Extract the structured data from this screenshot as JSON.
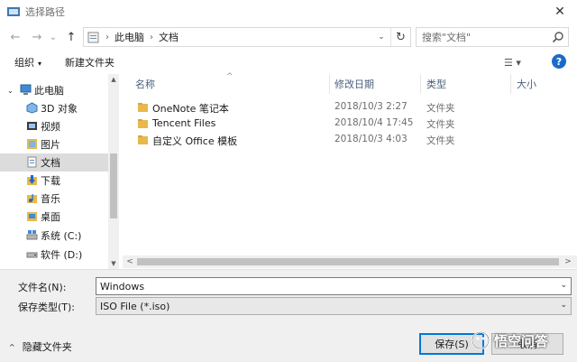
{
  "window": {
    "title": "选择路径",
    "close_glyph": "✕"
  },
  "nav": {
    "back_glyph": "←",
    "forward_glyph": "→",
    "recent_glyph": "⌄",
    "up_glyph": "↑",
    "breadcrumbs": [
      "此电脑",
      "文档"
    ],
    "separator_glyph": "›",
    "address_dropdown_glyph": "⌄",
    "refresh_glyph": "↻",
    "search_placeholder": "搜索\"文档\""
  },
  "toolbar": {
    "organize_label": "组织",
    "organize_caret": "▾",
    "new_folder_label": "新建文件夹",
    "view_glyph": "☰ ▾",
    "help_glyph": "?"
  },
  "sidebar": {
    "collapse_glyph": "⌄",
    "scroll_up_glyph": "▲",
    "scroll_down_glyph": "▼",
    "items": [
      {
        "label": "此电脑",
        "icon": "computer-icon"
      },
      {
        "label": "3D 对象",
        "icon": "cube-folder-icon"
      },
      {
        "label": "视频",
        "icon": "video-folder-icon"
      },
      {
        "label": "图片",
        "icon": "pictures-folder-icon"
      },
      {
        "label": "文档",
        "icon": "documents-folder-icon",
        "selected": true
      },
      {
        "label": "下载",
        "icon": "downloads-folder-icon"
      },
      {
        "label": "音乐",
        "icon": "music-folder-icon"
      },
      {
        "label": "桌面",
        "icon": "desktop-folder-icon"
      },
      {
        "label": "系统 (C:)",
        "icon": "system-drive-icon"
      },
      {
        "label": "软件 (D:)",
        "icon": "drive-icon"
      }
    ]
  },
  "files": {
    "columns": {
      "name": "名称",
      "modified": "修改日期",
      "type": "类型",
      "size": "大小"
    },
    "sort_glyph": "^",
    "rows": [
      {
        "name": "OneNote 笔记本",
        "modified": "2018/10/3 2:27",
        "type": "文件夹"
      },
      {
        "name": "Tencent Files",
        "modified": "2018/10/4 17:45",
        "type": "文件夹"
      },
      {
        "name": "自定义 Office 模板",
        "modified": "2018/10/3 4:03",
        "type": "文件夹"
      }
    ],
    "hscroll_left_glyph": "<",
    "hscroll_right_glyph": ">"
  },
  "form": {
    "filename_label": "文件名(N):",
    "filename_value": "Windows",
    "filetype_label": "保存类型(T):",
    "filetype_value": "ISO File (*.iso)",
    "dropdown_glyph": "⌄",
    "hide_folders_label": "隐藏文件夹",
    "hide_folders_caret": "^",
    "save_button": "保存(S)",
    "cancel_button": "取消"
  },
  "watermark": {
    "text": "悟空问答"
  },
  "colors": {
    "accent": "#0078d7",
    "folder": "#e8b84b",
    "selected": "#dcdcdc",
    "help": "#1a6bc9"
  }
}
